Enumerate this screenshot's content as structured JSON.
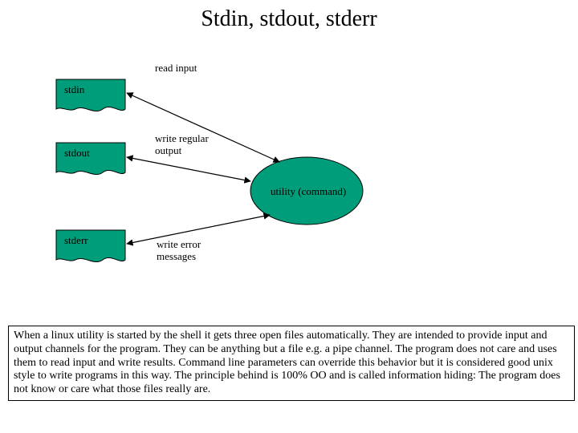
{
  "title": "Stdin, stdout, stderr",
  "labels": {
    "read_input": "read input",
    "write_regular_output": "write regular\noutput",
    "write_error_messages": "write error\nmessages"
  },
  "nodes": {
    "stdin": "stdin",
    "stdout": "stdout",
    "stderr": "stderr",
    "utility": "utility (command)"
  },
  "description": "When a linux utility is started by the shell it gets three open files automatically. They are intended to provide input and output channels for the program. They can be anything but a file e.g. a pipe channel. The program does not care and uses them to read input and write results. Command line parameters can override this behavior but it is considered good unix style to write programs in this way. The principle behind is 100% OO and is called information hiding: The program does not know or care what those files really are.",
  "colors": {
    "shape_fill": "#009d7a",
    "shape_stroke": "#000000"
  }
}
